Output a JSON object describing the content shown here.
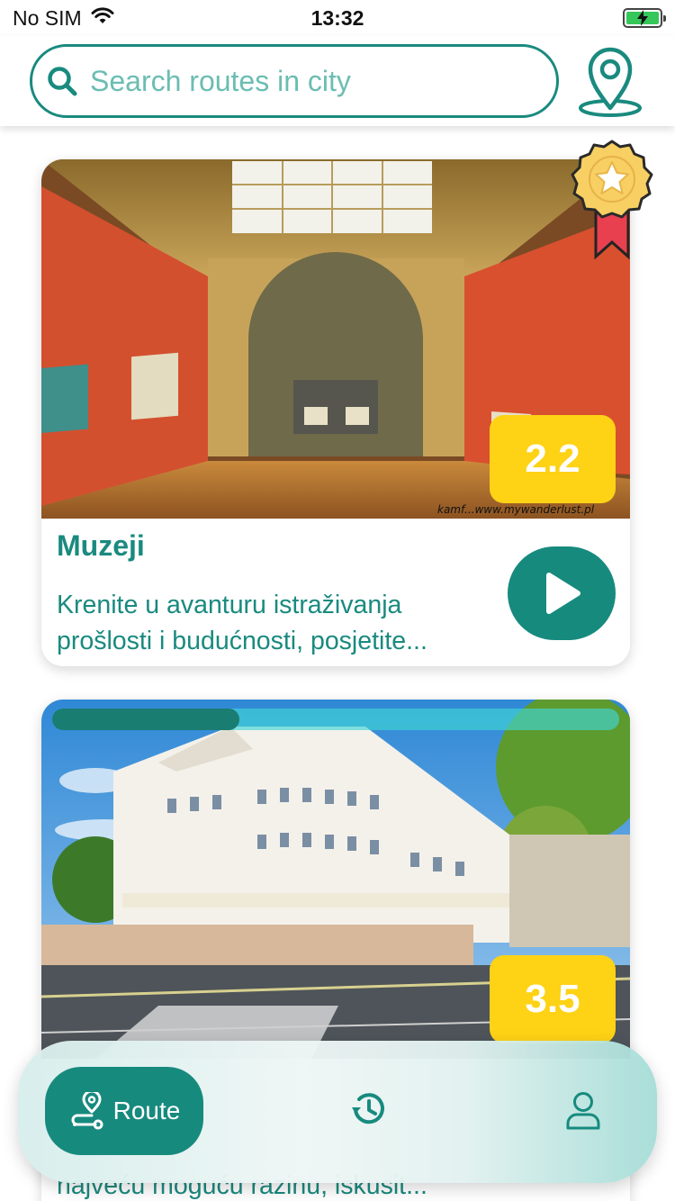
{
  "status_bar": {
    "carrier": "No SIM",
    "time": "13:32"
  },
  "search": {
    "placeholder": "Search routes in city",
    "value": ""
  },
  "colors": {
    "primary": "#178a7e",
    "rating": "#fed215",
    "award_gold": "#f8cf62",
    "award_ribbon": "#e8404f"
  },
  "icons": {
    "search": "search-icon",
    "map_pin": "map-pin-icon",
    "play": "play-icon",
    "award": "award-star-icon",
    "route": "route-icon",
    "history": "history-icon",
    "profile": "profile-icon"
  },
  "routes": [
    {
      "title": "Muzeji",
      "description_line1": "Krenite u avanturu istraživanja",
      "description_line2": "prošlosti i budućnosti, posjetite...",
      "rating": "2.2",
      "image_watermark": "kamf...www.mywanderlust.pl",
      "awarded": true
    },
    {
      "title": "",
      "description_partial": "najveću moguću razinu, iskusit...",
      "rating": "3.5",
      "progress": 0.33
    }
  ],
  "bottom_nav": {
    "route_label": "Route"
  }
}
